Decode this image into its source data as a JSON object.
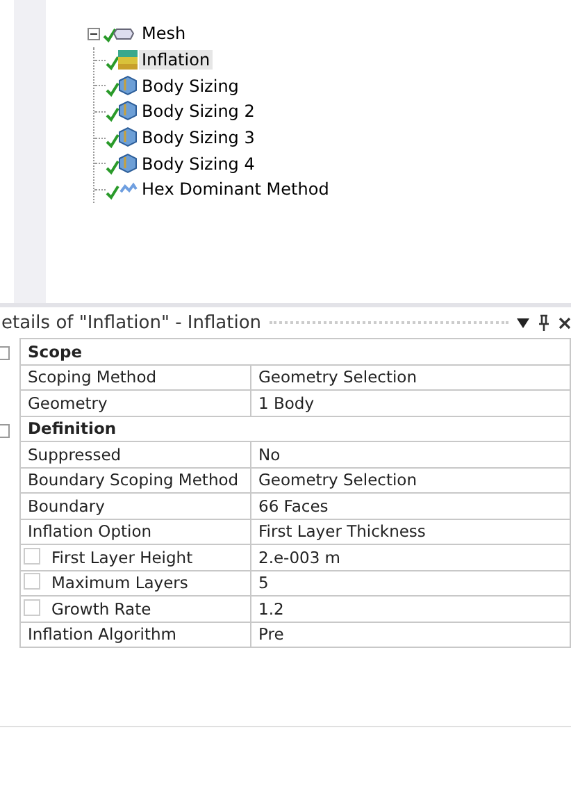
{
  "tree": {
    "label": "Mesh",
    "expanded": true,
    "children": [
      {
        "label": "Inflation",
        "selected": true,
        "kind": "inflation"
      },
      {
        "label": "Body Sizing",
        "selected": false,
        "kind": "sizing"
      },
      {
        "label": "Body Sizing 2",
        "selected": false,
        "kind": "sizing"
      },
      {
        "label": "Body Sizing 3",
        "selected": false,
        "kind": "sizing"
      },
      {
        "label": "Body Sizing 4",
        "selected": false,
        "kind": "sizing"
      },
      {
        "label": "Hex Dominant Method",
        "selected": false,
        "kind": "method"
      }
    ]
  },
  "details": {
    "title": "etails of \"Inflation\" - Inflation",
    "groups": [
      {
        "name": "Scope",
        "expanded": true,
        "rows": [
          {
            "kind": "plain",
            "label": "Scoping Method",
            "value": "Geometry Selection"
          },
          {
            "kind": "plain",
            "label": "Geometry",
            "value": "1 Body"
          }
        ]
      },
      {
        "name": "Definition",
        "expanded": true,
        "rows": [
          {
            "kind": "plain",
            "label": "Suppressed",
            "value": "No"
          },
          {
            "kind": "plain",
            "label": "Boundary Scoping Method",
            "value": "Geometry Selection"
          },
          {
            "kind": "plain",
            "label": "Boundary",
            "value": "66 Faces"
          },
          {
            "kind": "plain",
            "label": "Inflation Option",
            "value": "First Layer Thickness"
          },
          {
            "kind": "param",
            "checked": false,
            "label": "First Layer Height",
            "value": "2.e-003 m"
          },
          {
            "kind": "param",
            "checked": false,
            "label": "Maximum Layers",
            "value": "5"
          },
          {
            "kind": "param",
            "checked": false,
            "label": "Growth Rate",
            "value": "1.2"
          },
          {
            "kind": "plain",
            "label": "Inflation Algorithm",
            "value": "Pre"
          }
        ]
      }
    ]
  }
}
